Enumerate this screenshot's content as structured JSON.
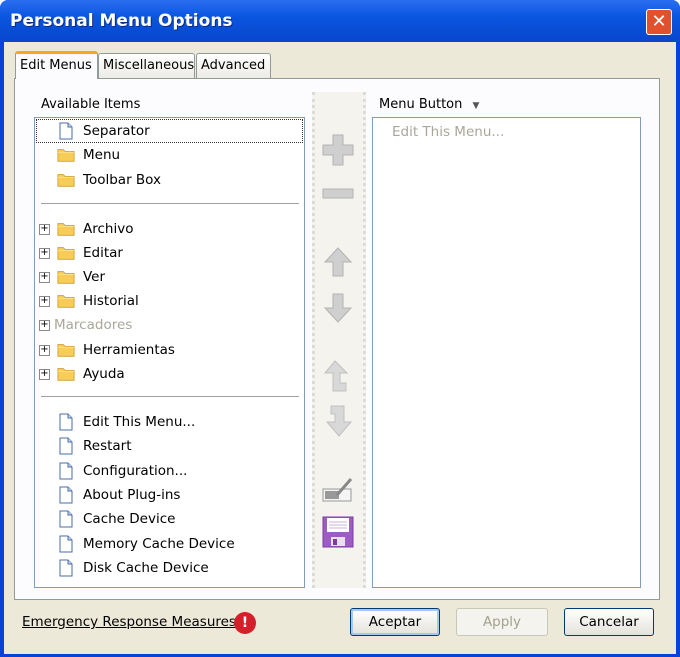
{
  "window": {
    "title": "Personal Menu Options",
    "close_icon": "close-icon"
  },
  "tabs": [
    {
      "label": "Edit Menus"
    },
    {
      "label": "Miscellaneous"
    },
    {
      "label": "Advanced"
    }
  ],
  "available": {
    "label": "Available Items",
    "group1": [
      {
        "label": "Separator",
        "icon": "page"
      },
      {
        "label": "Menu",
        "icon": "folder"
      },
      {
        "label": "Toolbar Box",
        "icon": "folder"
      }
    ],
    "group2": [
      {
        "label": "Archivo",
        "icon": "folder"
      },
      {
        "label": "Editar",
        "icon": "folder"
      },
      {
        "label": "Ver",
        "icon": "folder"
      },
      {
        "label": "Historial",
        "icon": "folder"
      },
      {
        "label": "Marcadores",
        "icon": "none",
        "disabled": true
      },
      {
        "label": "Herramientas",
        "icon": "folder"
      },
      {
        "label": "Ayuda",
        "icon": "folder"
      }
    ],
    "group3": [
      {
        "label": "Edit This Menu..."
      },
      {
        "label": "Restart"
      },
      {
        "label": "Configuration..."
      },
      {
        "label": "About Plug-ins"
      },
      {
        "label": "Cache Device"
      },
      {
        "label": "Memory Cache Device"
      },
      {
        "label": "Disk Cache Device"
      }
    ]
  },
  "menu": {
    "label": "Menu Button",
    "items": [
      {
        "label": "Edit This Menu..."
      }
    ]
  },
  "footer": {
    "link": "Emergency Response Measures",
    "ok": "Aceptar",
    "apply": "Apply",
    "cancel": "Cancelar"
  }
}
